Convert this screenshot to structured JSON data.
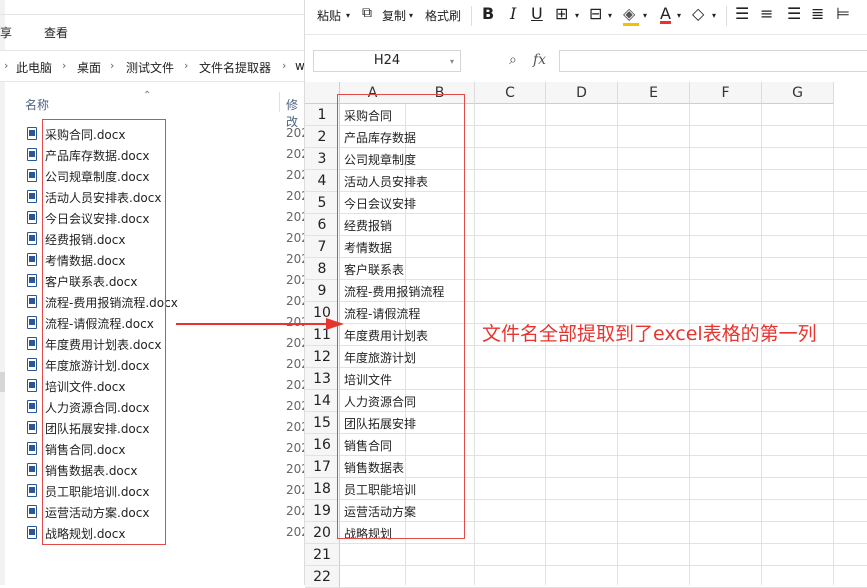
{
  "explorer": {
    "menu": {
      "share": "享",
      "view": "查看"
    },
    "breadcrumb": [
      "此电脑",
      "桌面",
      "测试文件",
      "文件名提取器",
      "w"
    ],
    "columns": {
      "name": "名称",
      "date": "修改"
    },
    "files": [
      {
        "name": "采购合同.docx",
        "date": "202"
      },
      {
        "name": "产品库存数据.docx",
        "date": "202"
      },
      {
        "name": "公司规章制度.docx",
        "date": "202"
      },
      {
        "name": "活动人员安排表.docx",
        "date": "202"
      },
      {
        "name": "今日会议安排.docx",
        "date": "202"
      },
      {
        "name": "经费报销.docx",
        "date": "202"
      },
      {
        "name": "考情数据.docx",
        "date": "202"
      },
      {
        "name": "客户联系表.docx",
        "date": "202"
      },
      {
        "name": "流程-费用报销流程.docx",
        "date": "202"
      },
      {
        "name": "流程-请假流程.docx",
        "date": "202"
      },
      {
        "name": "年度费用计划表.docx",
        "date": "202"
      },
      {
        "name": "年度旅游计划.docx",
        "date": "202"
      },
      {
        "name": "培训文件.docx",
        "date": "202"
      },
      {
        "name": "人力资源合同.docx",
        "date": "202"
      },
      {
        "name": "团队拓展安排.docx",
        "date": "202"
      },
      {
        "name": "销售合同.docx",
        "date": "202"
      },
      {
        "name": "销售数据表.docx",
        "date": "202"
      },
      {
        "name": "员工职能培训.docx",
        "date": "202"
      },
      {
        "name": "运营活动方案.docx",
        "date": "202"
      },
      {
        "name": "战略规划.docx",
        "date": "202"
      }
    ]
  },
  "toolbar": {
    "paste": "粘贴",
    "copy": "复制",
    "format_painter": "格式刷",
    "bold": "B",
    "italic": "I",
    "underline": "U",
    "font_color_letter": "A"
  },
  "formula_bar": {
    "cell_ref": "H24",
    "fx": "fx",
    "value": ""
  },
  "sheet": {
    "columns": [
      "A",
      "B",
      "C",
      "D",
      "E",
      "F",
      "G"
    ],
    "rows": [
      {
        "num": "1",
        "a": "采购合同"
      },
      {
        "num": "2",
        "a": "产品库存数据"
      },
      {
        "num": "3",
        "a": "公司规章制度"
      },
      {
        "num": "4",
        "a": "活动人员安排表"
      },
      {
        "num": "5",
        "a": "今日会议安排"
      },
      {
        "num": "6",
        "a": "经费报销"
      },
      {
        "num": "7",
        "a": "考情数据"
      },
      {
        "num": "8",
        "a": "客户联系表"
      },
      {
        "num": "9",
        "a": "流程-费用报销流程"
      },
      {
        "num": "10",
        "a": "流程-请假流程"
      },
      {
        "num": "11",
        "a": "年度费用计划表"
      },
      {
        "num": "12",
        "a": "年度旅游计划"
      },
      {
        "num": "13",
        "a": "培训文件"
      },
      {
        "num": "14",
        "a": "人力资源合同"
      },
      {
        "num": "15",
        "a": "团队拓展安排"
      },
      {
        "num": "16",
        "a": "销售合同"
      },
      {
        "num": "17",
        "a": "销售数据表"
      },
      {
        "num": "18",
        "a": "员工职能培训"
      },
      {
        "num": "19",
        "a": "运营活动方案"
      },
      {
        "num": "20",
        "a": "战略规划"
      },
      {
        "num": "21",
        "a": ""
      },
      {
        "num": "22",
        "a": ""
      }
    ]
  },
  "annotation": "文件名全部提取到了excel表格的第一列",
  "colors": {
    "annotation_red": "#e8342e",
    "word_blue": "#2b5797",
    "highlight_yellow": "#f2c200"
  }
}
